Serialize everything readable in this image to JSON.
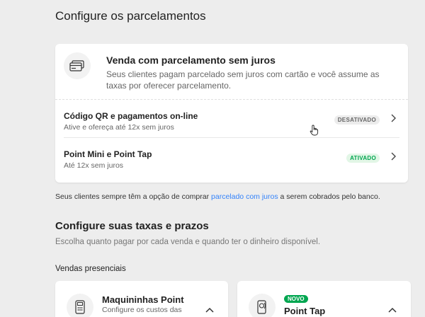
{
  "page": {
    "title": "Configure os parcelamentos"
  },
  "installments_card": {
    "title": "Venda com parcelamento sem juros",
    "description": "Seus clientes pagam parcelado sem juros com cartão e você assume as taxas por oferecer parcelamento.",
    "icon": "credit-cards-icon",
    "rows": [
      {
        "title": "Código QR e pagamentos on-line",
        "subtitle": "Ative e ofereça até 12x sem juros",
        "status": "DESATIVADO"
      },
      {
        "title": "Point Mini e Point Tap",
        "subtitle": "Até 12x sem juros",
        "status": "ATIVADO"
      }
    ]
  },
  "footnote": {
    "before": "Seus clientes sempre têm a opção de comprar ",
    "link": "parcelado com juros",
    "after": " a serem cobrados pelo banco."
  },
  "fees_section": {
    "title": "Configure suas taxas e prazos",
    "subtitle": "Escolha quanto pagar por cada venda e quando ter o dinheiro disponível.",
    "group_title": "Vendas presenciais",
    "cards": [
      {
        "title": "Maquininhas Point",
        "subtitle": "Configure os custos das",
        "icon": "card-machine-icon"
      },
      {
        "badge": "NOVO",
        "title": "Point Tap",
        "icon": "phone-tap-icon"
      }
    ]
  },
  "colors": {
    "accent_link": "#3483fa",
    "active_green": "#00a650",
    "background": "#ededed"
  }
}
